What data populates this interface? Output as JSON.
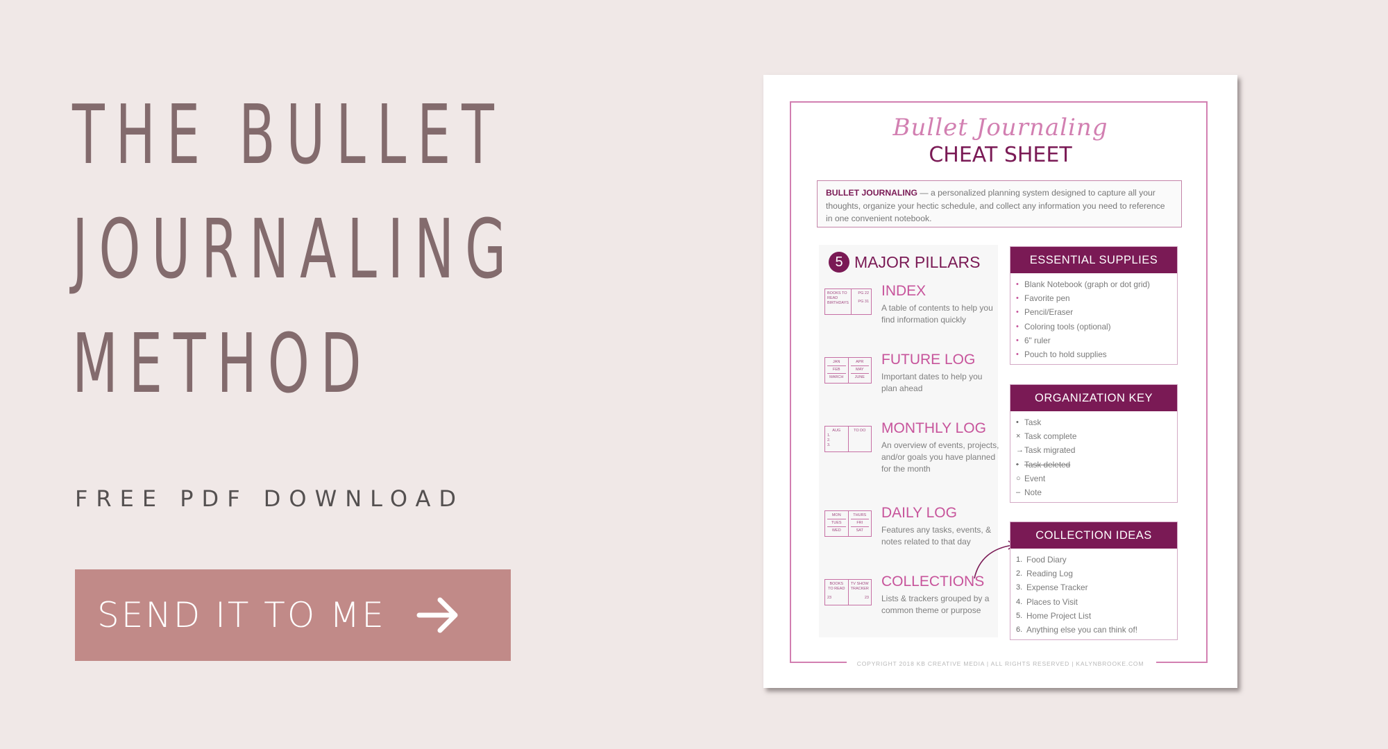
{
  "headline": {
    "lines": [
      "THE BULLET",
      "JOURNALING",
      "METHOD"
    ]
  },
  "subhead": "FREE PDF DOWNLOAD",
  "cta": {
    "label": "SEND IT TO ME",
    "icon": "arrow-right-icon"
  },
  "colors": {
    "background": "#f0e8e7",
    "headline": "#836b6d",
    "button": "#c18a88",
    "sheet_accent": "#7a1a55",
    "sheet_pink": "#d27fb1"
  },
  "sheet": {
    "script_title": "Bullet Journaling",
    "title": "CHEAT SHEET",
    "intro_term": "BULLET JOURNALING",
    "intro_text": " — a personalized planning system designed to capture all your thoughts, organize your hectic schedule, and collect any information you need to reference in one convenient notebook.",
    "pillars": {
      "number": "5",
      "title": "MAJOR PILLARS",
      "items": [
        {
          "name": "INDEX",
          "desc": "A table of contents to help you find information quickly",
          "mini_left": [
            "BOOKS TO READ",
            "BIRTHDAYS"
          ],
          "mini_right": [
            "PG 22",
            "PG 31"
          ]
        },
        {
          "name": "FUTURE LOG",
          "desc": "Important dates to help you plan ahead",
          "mini_left": [
            "JAN",
            "FEB",
            "MARCH"
          ],
          "mini_right": [
            "APR",
            "MAY",
            "JUNE"
          ]
        },
        {
          "name": "MONTHLY LOG",
          "desc": "An overview of events, projects, and/or goals you have planned for the month",
          "mini_left": [
            "AUG",
            "1.",
            "2.",
            "3."
          ],
          "mini_right": [
            "TO DO"
          ]
        },
        {
          "name": "DAILY LOG",
          "desc": "Features any tasks, events, & notes related to that day",
          "mini_left": [
            "MON",
            "TUES",
            "WED"
          ],
          "mini_right": [
            "THURS",
            "FRI",
            "SAT"
          ]
        },
        {
          "name": "COLLECTIONS",
          "desc": "Lists & trackers grouped by a common theme or purpose",
          "mini_left": [
            "BOOKS TO READ",
            "23"
          ],
          "mini_right": [
            "TV SHOW TRACKER",
            "23"
          ]
        }
      ]
    },
    "supplies": {
      "title": "ESSENTIAL SUPPLIES",
      "items": [
        "Blank Notebook (graph or dot grid)",
        "Favorite pen",
        "Pencil/Eraser",
        "Coloring tools (optional)",
        "6\" ruler",
        "Pouch to hold supplies"
      ]
    },
    "org_key": {
      "title": "ORGANIZATION KEY",
      "items": [
        {
          "symbol": "•",
          "label": "Task"
        },
        {
          "symbol": "×",
          "label": "Task complete"
        },
        {
          "symbol": "→",
          "label": "Task migrated"
        },
        {
          "symbol": "•",
          "label": "Task deleted"
        },
        {
          "symbol": "○",
          "label": "Event"
        },
        {
          "symbol": "–",
          "label": "Note"
        }
      ]
    },
    "collection_ideas": {
      "title": "COLLECTION IDEAS",
      "items": [
        {
          "num": "1.",
          "label": "Food Diary"
        },
        {
          "num": "2.",
          "label": "Reading Log"
        },
        {
          "num": "3.",
          "label": "Expense Tracker"
        },
        {
          "num": "4.",
          "label": "Places to Visit"
        },
        {
          "num": "5.",
          "label": "Home Project List"
        },
        {
          "num": "6.",
          "label": "Anything else you can think of!"
        }
      ]
    },
    "footer": "COPYRIGHT 2018 KB CREATIVE MEDIA  |  ALL RIGHTS RESERVED  |  KALYNBROOKE.COM"
  }
}
